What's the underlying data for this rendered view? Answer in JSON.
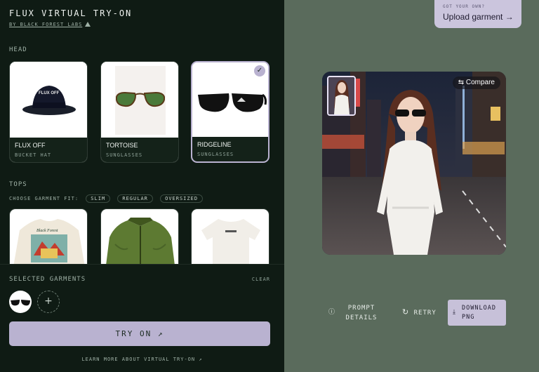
{
  "app": {
    "title": "FLUX VIRTUAL TRY-ON",
    "byline": "BY BLACK FOREST LABS"
  },
  "head_section": {
    "label": "HEAD",
    "items": [
      {
        "name": "FLUX OFF",
        "type": "BUCKET HAT",
        "selected": false
      },
      {
        "name": "TORTOISE",
        "type": "SUNGLASSES",
        "selected": false
      },
      {
        "name": "RIDGELINE",
        "type": "SUNGLASSES",
        "selected": true
      }
    ],
    "check_glyph": "✓"
  },
  "tops_section": {
    "label": "TOPS",
    "fit_label": "CHOOSE GARMENT FIT:",
    "fit_options": [
      "SLIM",
      "REGULAR",
      "OVERSIZED"
    ]
  },
  "selected": {
    "label": "SELECTED GARMENTS",
    "clear_label": "CLEAR",
    "add_glyph": "+"
  },
  "try_on_button": "TRY ON ↗",
  "learn_more": "LEARN MORE ABOUT VIRTUAL TRY-ON ↗",
  "upload": {
    "hint": "GOT YOUR OWN?",
    "label": "Upload garment →"
  },
  "result": {
    "compare_label": "Compare",
    "compare_icon": "⇆"
  },
  "actions": {
    "prompt_icon": "ⓘ",
    "prompt_line1": "PROMPT",
    "prompt_line2": "DETAILS",
    "retry_icon": "↻",
    "retry_label": "RETRY",
    "download_icon": "⤓",
    "download_line1": "DOWNLOAD",
    "download_line2": "PNG"
  },
  "colors": {
    "left_bg": "#0f1b14",
    "right_bg": "#5a6b5c",
    "accent": "#b9b2d0"
  }
}
